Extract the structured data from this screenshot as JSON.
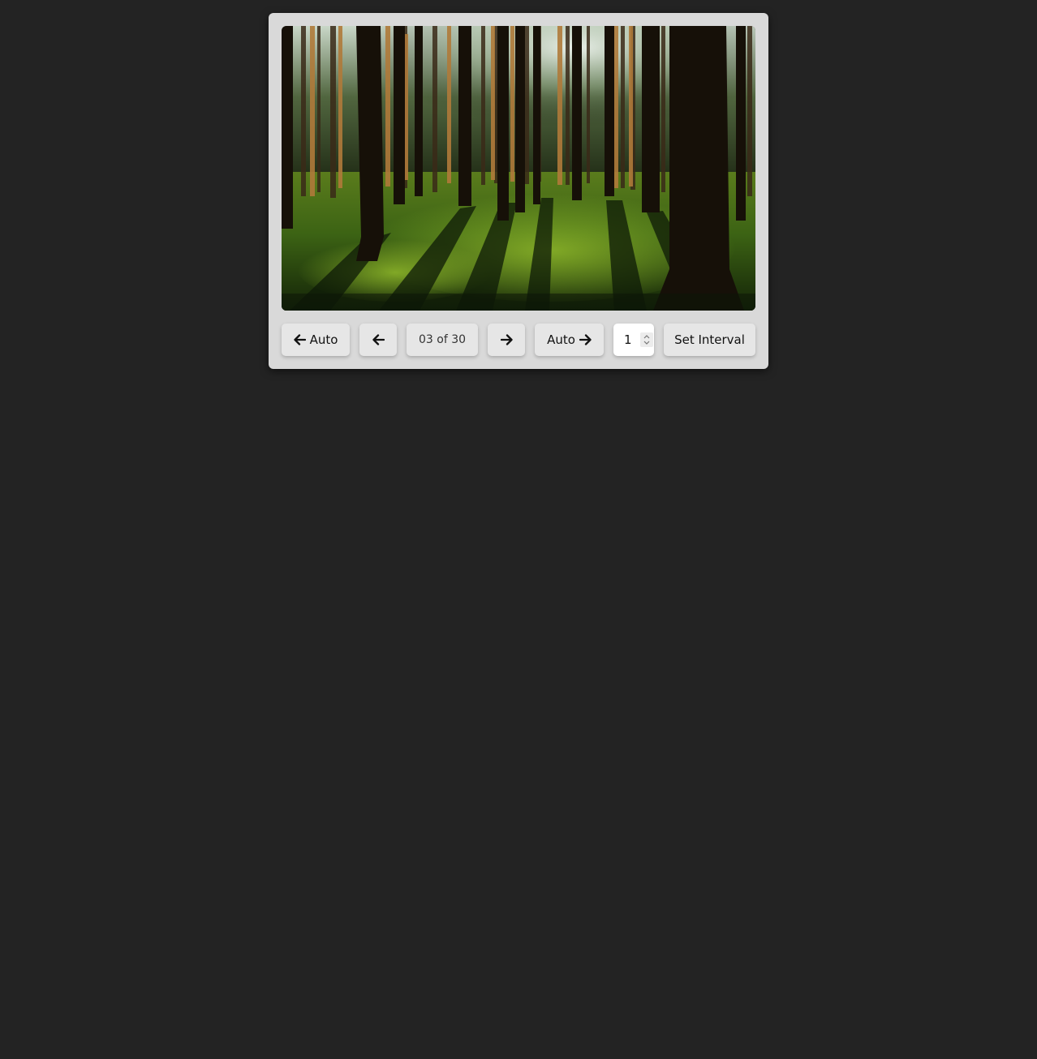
{
  "slideshow": {
    "current_image": {
      "description_name": "forest-image"
    },
    "controls": {
      "auto_prev_label": "Auto",
      "counter_text": "03 of 30",
      "auto_next_label": "Auto",
      "interval_value": "1",
      "set_interval_label": "Set Interval"
    },
    "icons": {
      "prev": "arrow-left-icon",
      "next": "arrow-right-icon",
      "spin_up": "chevron-up-icon",
      "spin_down": "chevron-down-icon"
    }
  }
}
